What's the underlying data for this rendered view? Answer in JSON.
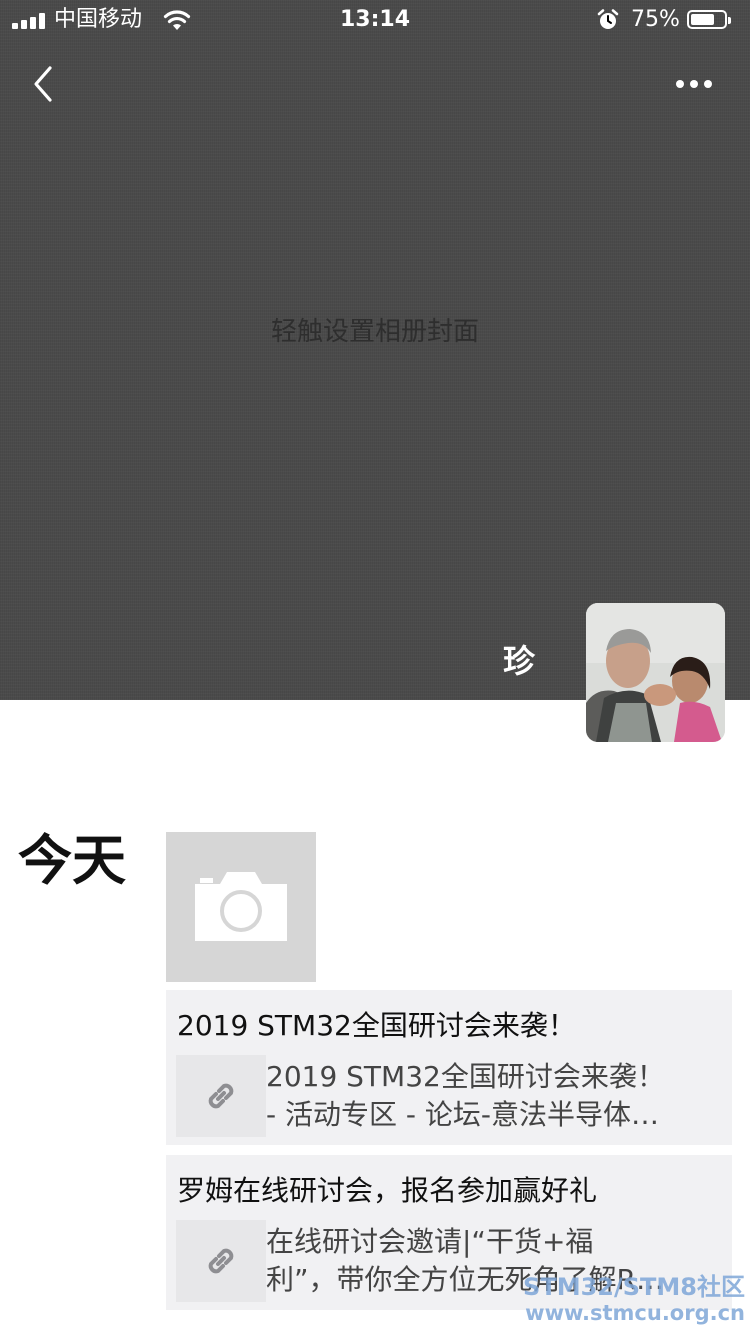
{
  "status_bar": {
    "carrier": "中国移动",
    "time": "13:14",
    "battery_percent": "75%",
    "battery_level": 0.75,
    "icons": [
      "signal-icon",
      "wifi-icon",
      "alarm-icon",
      "battery-icon"
    ]
  },
  "header": {
    "back_icon": "chevron-left-icon",
    "more_icon": "more-dots-icon"
  },
  "cover": {
    "hint": "轻触设置相册封面",
    "color": "#4b4b4b"
  },
  "profile": {
    "name": "珍"
  },
  "feed": {
    "date_label": "今天",
    "camera_icon": "camera-icon",
    "posts": [
      {
        "title": "2019 STM32全国研讨会来袭！",
        "desc_line1": "2019 STM32全国研讨会来袭！",
        "desc_line2": "- 活动专区 - 论坛-意法半导体…",
        "icon": "link-icon"
      },
      {
        "title": "罗姆在线研讨会，报名参加赢好礼",
        "desc_line1": "在线研讨会邀请|“干货+福",
        "desc_line2": "利”，带你全方位无死角了解R…",
        "icon": "link-icon"
      }
    ]
  },
  "watermark": {
    "line1": "STM32/STM8社区",
    "line2": "www.stmcu.org.cn"
  }
}
